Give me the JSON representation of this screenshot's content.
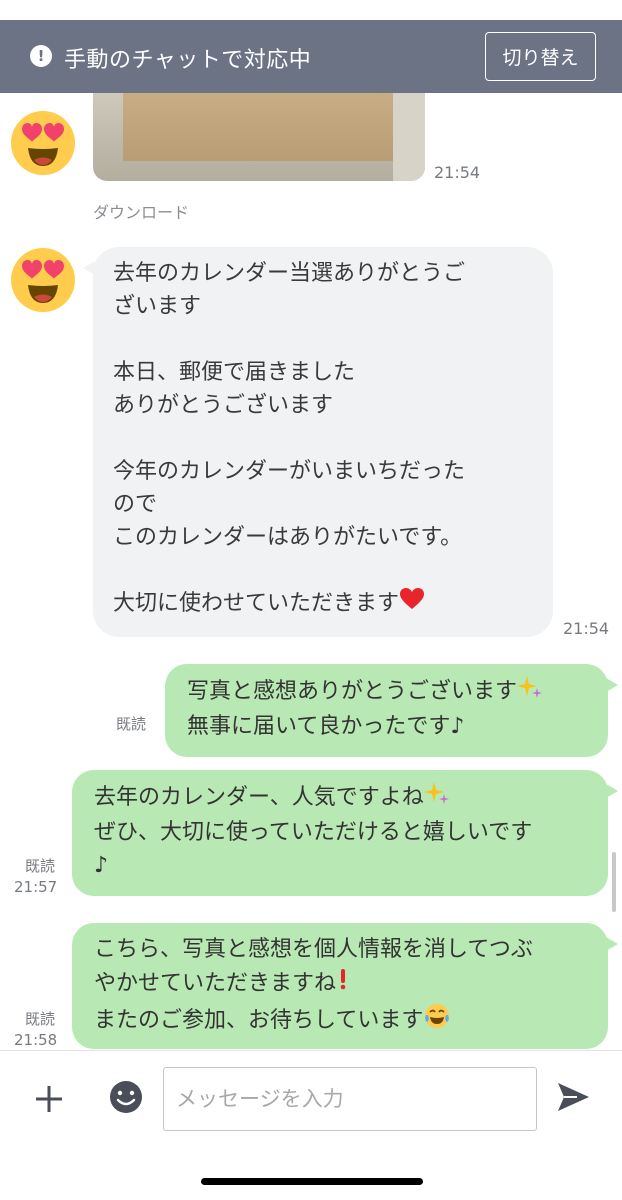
{
  "banner": {
    "text": "手動のチャットで対応中",
    "switch_label": "切り替え",
    "alert_icon": "!",
    "bg_color": "#6b7385"
  },
  "messages": {
    "photo_time": "21:54",
    "download_label": "ダウンロード",
    "incoming_text": "去年のカレンダー当選ありがとうご\nざいます\n\n本日、郵便で届きました\nありがとうございます\n\n今年のカレンダーがいまいちだった\nので\nこのカレンダーはありがたいです。\n\n大切に使わせていただきます",
    "incoming_time": "21:54",
    "out1_text": "写真と感想ありがとうございます",
    "out1_text2": "無事に届いて良かったです♪",
    "out1_read": "既読",
    "out2_text": "去年のカレンダー、人気ですよね",
    "out2_text2": "ぜひ、大切に使っていただけると嬉しいです\n♪",
    "out2_read": "既読",
    "out2_time": "21:57",
    "out3_text": "こちら、写真と感想を個人情報を消してつぶ\nやかせていただきますね",
    "out3_text2": "またのご参加、お待ちしています",
    "out3_read": "既読",
    "out3_time": "21:58"
  },
  "composer": {
    "placeholder": "メッセージを入力"
  },
  "colors": {
    "outgoing_bubble": "#b8e8b3",
    "incoming_bubble": "#f1f2f4"
  },
  "icons": {
    "avatar": "heart-eyes-emoji",
    "sparkles": "sparkles-icon",
    "heart": "red-heart-icon",
    "exclamation": "red-exclamation-icon",
    "tears_of_joy": "tears-of-joy-icon",
    "plus": "plus-icon",
    "smiley": "smiley-icon",
    "send": "send-icon"
  }
}
